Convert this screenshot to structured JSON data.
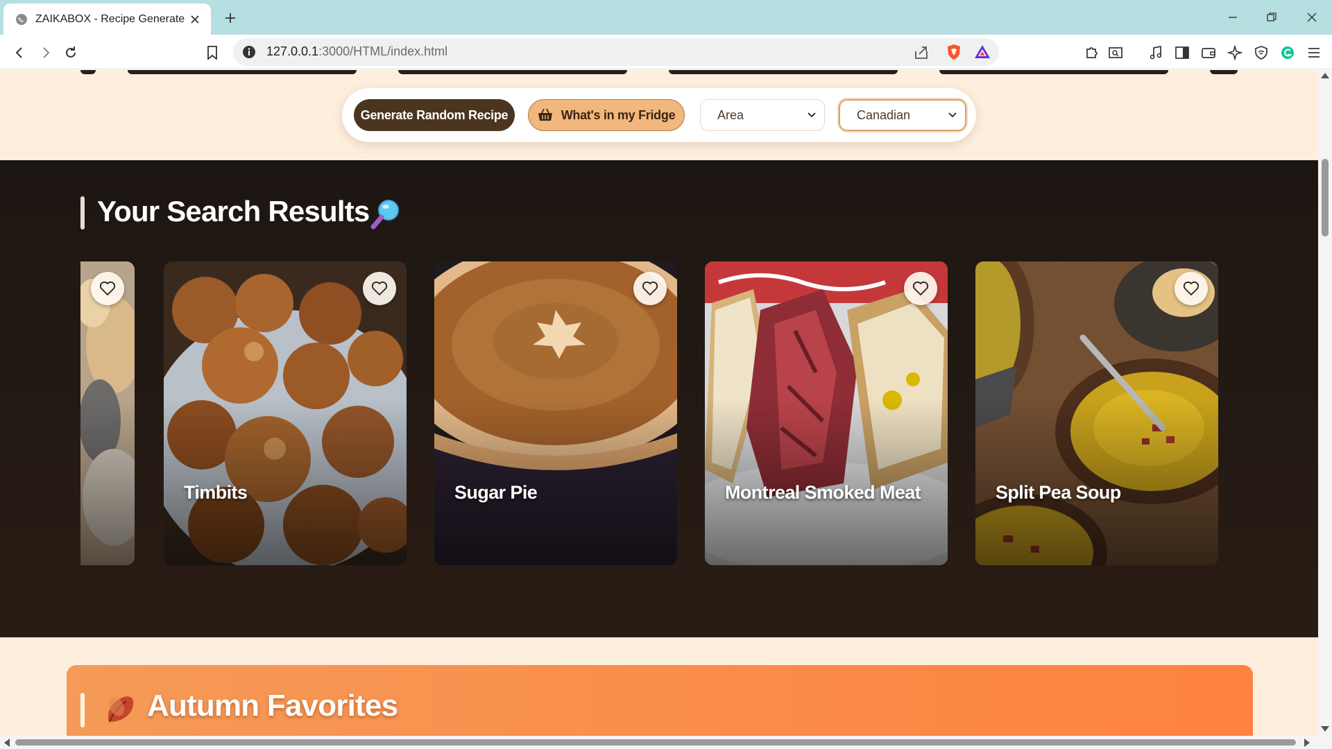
{
  "browser": {
    "tab_title": "ZAIKABOX - Recipe Generate",
    "url_host": "127.0.0.1",
    "url_path": ":3000/HTML/index.html"
  },
  "controls": {
    "random_label": "Generate Random Recipe",
    "fridge_label": "What's in my Fridge",
    "area_select": "Area",
    "cuisine_select": "Canadian"
  },
  "results": {
    "title": "Your Search Results",
    "cards": [
      {
        "title": ""
      },
      {
        "title": "Timbits"
      },
      {
        "title": "Sugar Pie"
      },
      {
        "title": "Montreal Smoked Meat"
      },
      {
        "title": "Split Pea Soup"
      }
    ]
  },
  "autumn": {
    "title": "Autumn Favorites"
  },
  "colors": {
    "brown_primary": "#4b3520",
    "fridge_button": "#f2b77d",
    "results_bg": "#1c1612",
    "page_bg": "#fdeedd",
    "autumn_orange": "#ff8240"
  }
}
